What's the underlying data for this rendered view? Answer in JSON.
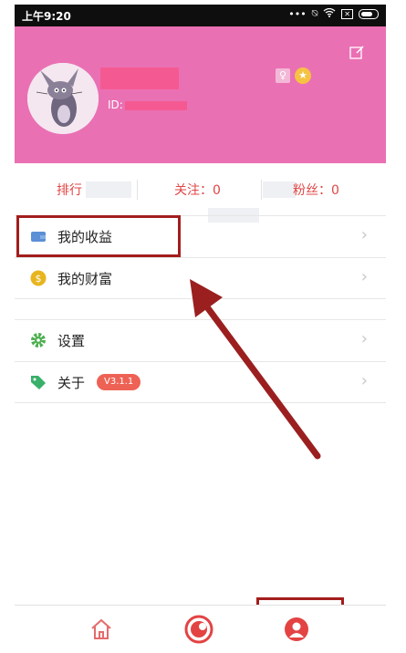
{
  "status_bar": {
    "time": "上午9:20",
    "icons": [
      "dots-icon",
      "mute-icon",
      "wifi-icon",
      "sim-icon",
      "battery-icon"
    ]
  },
  "profile": {
    "id_label": "ID:",
    "gender_symbol": "♀",
    "level_symbol": "★"
  },
  "stats": {
    "rank": "排行",
    "follow": "关注：0",
    "fans": "粉丝：0"
  },
  "menu": {
    "earnings": "我的收益",
    "wealth": "我的财富",
    "settings": "设置",
    "about": "关于",
    "version": "V3.1.1"
  },
  "bottom_nav": {
    "tabs": [
      "home-icon",
      "live-icon",
      "profile-icon"
    ]
  },
  "colors": {
    "header": "#ea70b4",
    "accent": "#e04646",
    "annotation": "#a31d1d"
  }
}
